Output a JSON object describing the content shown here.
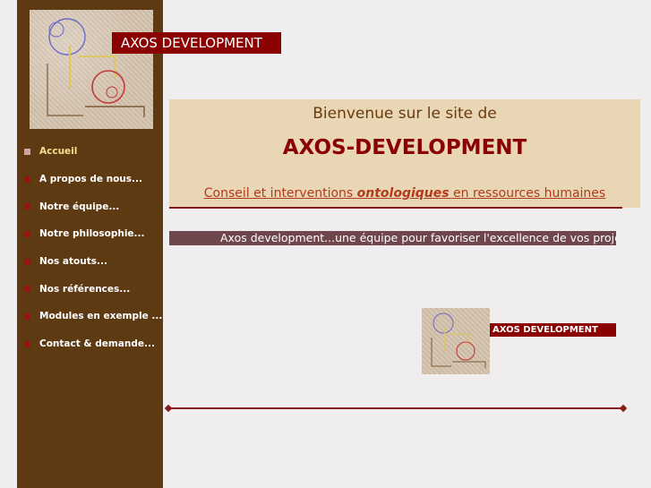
{
  "header": {
    "logo_title": "AXOS DEVELOPMENT"
  },
  "nav": {
    "items": [
      {
        "label": "Accueil",
        "active": true
      },
      {
        "label": "A propos de nous..."
      },
      {
        "label": "Notre équipe..."
      },
      {
        "label": "Notre philosophie..."
      },
      {
        "label": "Nos atouts..."
      },
      {
        "label": "Nos références..."
      },
      {
        "label": "Modules en exemple ..."
      },
      {
        "label": "Contact  & demande..."
      }
    ]
  },
  "welcome": {
    "line1": "Bienvenue sur le site de",
    "line2": "AXOS-DEVELOPMENT",
    "line3_before": "Conseil et interventions ",
    "line3_keyword": "ontologiques",
    "line3_after": " en ressources humaines"
  },
  "marquee": {
    "text": "Axos development...une équipe pour favoriser l'excellence de vos projets"
  },
  "footer_logo": {
    "title": "AXOS DEVELOPMENT"
  },
  "colors": {
    "sidebar": "#5e3a12",
    "accent": "#8b0000",
    "welcome_bg": "#e9d6b5",
    "marquee_bg": "#6e464c"
  }
}
